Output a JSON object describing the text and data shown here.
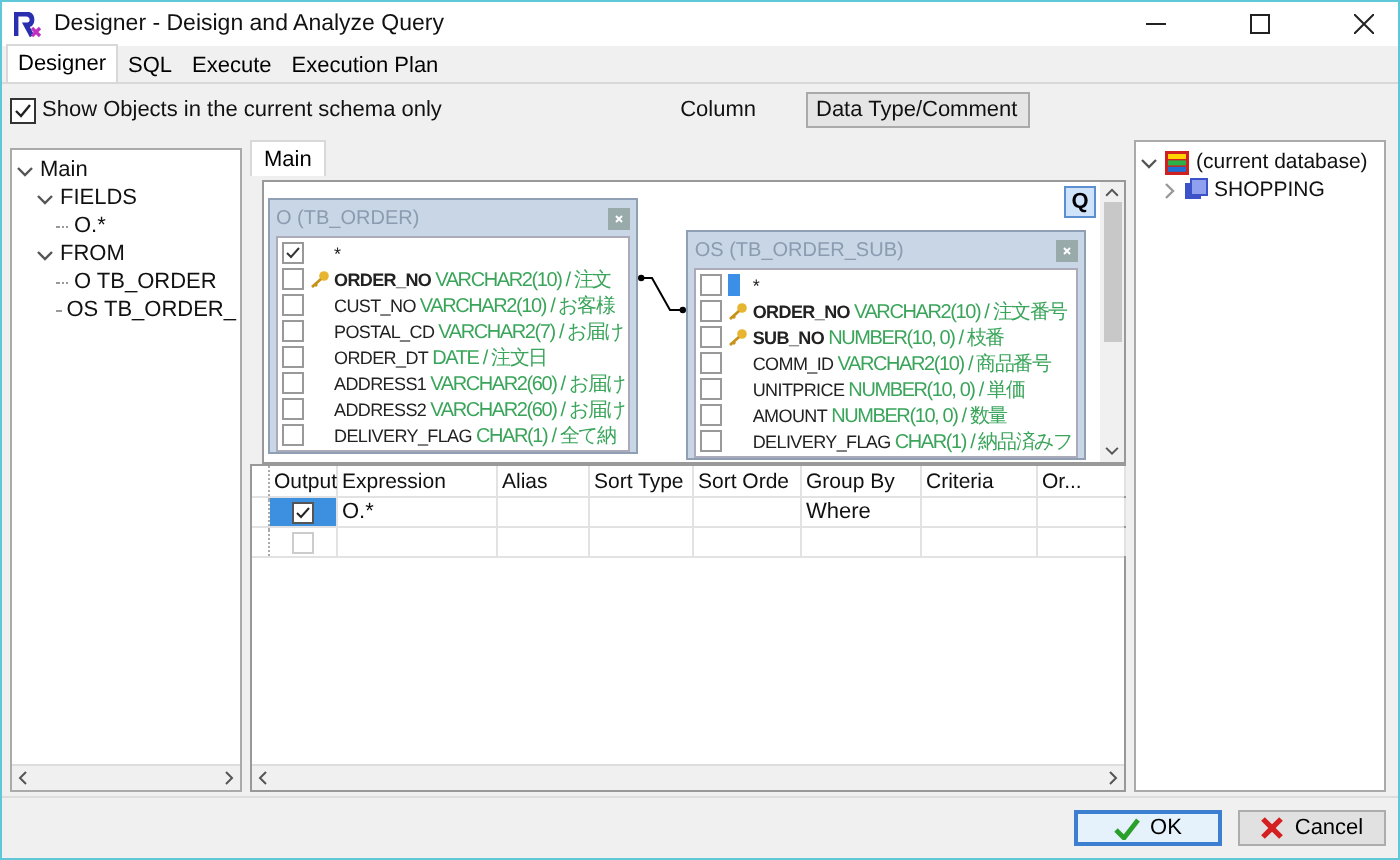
{
  "window": {
    "title": "Designer - Deisign and Analyze Query"
  },
  "tabs": [
    {
      "label": "Designer",
      "selected": true
    },
    {
      "label": "SQL",
      "selected": false
    },
    {
      "label": "Execute",
      "selected": false
    },
    {
      "label": "Execution Plan",
      "selected": false
    }
  ],
  "options": {
    "schema_only": {
      "label": "Show Objects in the current schema only",
      "checked": true
    },
    "column": {
      "label": "Column",
      "value": "Data Type/Comment"
    }
  },
  "query_tree": [
    {
      "label": "Main",
      "expanded": true,
      "children": [
        {
          "label": "FIELDS",
          "expanded": true,
          "children": [
            {
              "label": "O.*"
            }
          ]
        },
        {
          "label": "FROM",
          "expanded": true,
          "children": [
            {
              "label": "O TB_ORDER"
            },
            {
              "label": "OS TB_ORDER_"
            }
          ]
        }
      ]
    }
  ],
  "designer": {
    "tabs": [
      {
        "label": "Main",
        "selected": true
      }
    ],
    "q_button": "Q",
    "tables": [
      {
        "title": "O (TB_ORDER)",
        "fields": [
          {
            "name": "*",
            "checked": true,
            "key": false,
            "selected": false
          },
          {
            "name": "ORDER_NO",
            "type": "VARCHAR2(10) / 注文",
            "checked": false,
            "key": true,
            "selected": false
          },
          {
            "name": "CUST_NO",
            "type": "VARCHAR2(10) / お客様",
            "checked": false,
            "key": false,
            "selected": false
          },
          {
            "name": "POSTAL_CD",
            "type": "VARCHAR2(7) / お届け",
            "checked": false,
            "key": false,
            "selected": false
          },
          {
            "name": "ORDER_DT",
            "type": "DATE / 注文日",
            "checked": false,
            "key": false,
            "selected": false
          },
          {
            "name": "ADDRESS1",
            "type": "VARCHAR2(60) / お届け",
            "checked": false,
            "key": false,
            "selected": false
          },
          {
            "name": "ADDRESS2",
            "type": "VARCHAR2(60) / お届け",
            "checked": false,
            "key": false,
            "selected": false
          },
          {
            "name": "DELIVERY_FLAG",
            "type": "CHAR(1) / 全て納",
            "checked": false,
            "key": false,
            "selected": false
          }
        ]
      },
      {
        "title": "OS (TB_ORDER_SUB)",
        "fields": [
          {
            "name": "*",
            "checked": false,
            "key": false,
            "selected": true
          },
          {
            "name": "ORDER_NO",
            "type": "VARCHAR2(10) / 注文番号",
            "checked": false,
            "key": true,
            "selected": false
          },
          {
            "name": "SUB_NO",
            "type": "NUMBER(10, 0) / 枝番",
            "checked": false,
            "key": true,
            "selected": false
          },
          {
            "name": "COMM_ID",
            "type": "VARCHAR2(10) / 商品番号",
            "checked": false,
            "key": false,
            "selected": false
          },
          {
            "name": "UNITPRICE",
            "type": "NUMBER(10, 0) / 単価",
            "checked": false,
            "key": false,
            "selected": false
          },
          {
            "name": "AMOUNT",
            "type": "NUMBER(10, 0) / 数量",
            "checked": false,
            "key": false,
            "selected": false
          },
          {
            "name": "DELIVERY_FLAG",
            "type": "CHAR(1) / 納品済みフ",
            "checked": false,
            "key": false,
            "selected": false
          }
        ]
      }
    ]
  },
  "grid": {
    "columns": [
      "Output",
      "Expression",
      "Alias",
      "Sort Type",
      "Sort Orde",
      "Group By",
      "Criteria",
      "Or..."
    ],
    "rows": [
      {
        "output": true,
        "disabled": false,
        "selected": true,
        "expression": "O.*",
        "group_by": "Where"
      },
      {
        "output": false,
        "disabled": true,
        "selected": false
      }
    ]
  },
  "database_tree": [
    {
      "label": "(current database)",
      "kind": "database",
      "expanded": true,
      "children": [
        {
          "label": "SHOPPING",
          "kind": "schema",
          "expanded": false
        }
      ]
    }
  ],
  "buttons": [
    {
      "label": "OK",
      "kind": "ok",
      "focused": true
    },
    {
      "label": "Cancel",
      "kind": "cancel",
      "focused": false
    }
  ]
}
